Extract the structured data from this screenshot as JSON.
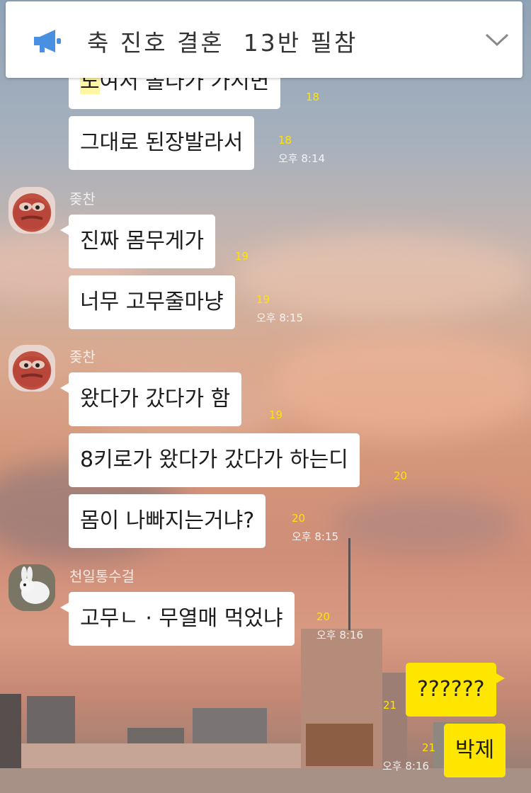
{
  "notice": {
    "icon": "megaphone-icon",
    "title": "축 진호 결혼  13반 필참",
    "accent": "#4a90e2"
  },
  "messages": [
    {
      "text_hl": "도",
      "text": "여서 돌다가 가시면",
      "count": "18"
    },
    {
      "text": "그대로 된장발라서",
      "count": "18",
      "time": "오후 8:14"
    },
    {
      "sender": "좆찬",
      "text": "진짜 몸무게가",
      "count": "19"
    },
    {
      "text": "너무 고무줄마냥",
      "count": "19",
      "time": "오후 8:15"
    },
    {
      "sender": "좆찬",
      "text": "왔다가 갔다가 함",
      "count": "19"
    },
    {
      "text": "8키로가 왔다가 갔다가 하는디",
      "count": "20"
    },
    {
      "text": "몸이 나빠지는거냐?",
      "count": "20",
      "time": "오후 8:15"
    },
    {
      "sender": "천일통수걸",
      "text": "고무ㄴ · 무열매 먹었냐",
      "count": "20",
      "time": "오후 8:16"
    },
    {
      "text": "??????",
      "count": "21",
      "mine": true
    },
    {
      "text": "박제",
      "count": "21",
      "time": "오후 8:16",
      "mine": true
    }
  ],
  "colors": {
    "my_bubble": "#ffe600",
    "unread_count": "#ffe400"
  }
}
